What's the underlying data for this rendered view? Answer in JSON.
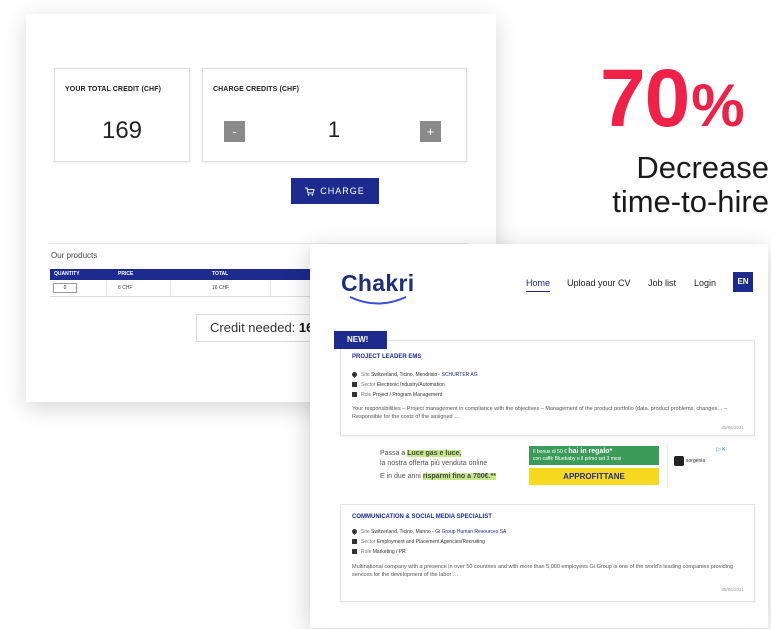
{
  "credit_panel": {
    "total_title": "YOUR TOTAL CREDIT (CHF)",
    "total_value": "169",
    "charge_title": "CHARGE CREDITS (CHF)",
    "minus_label": "-",
    "plus_label": "+",
    "charge_value": "1",
    "charge_button": "CHARGE",
    "products_title": "Our products",
    "products_columns": [
      "QUANTITY",
      "PRICE",
      "TOTAL"
    ],
    "products_row": {
      "quantity": "0",
      "price": "8 CHF",
      "total": "16 CHF"
    },
    "credit_needed_label": "Credit needed:",
    "credit_needed_value": "16"
  },
  "headline": {
    "stat": "70",
    "percent": "%",
    "caption_line1": "Decrease",
    "caption_line2": "time-to-hire"
  },
  "site": {
    "logo": "Chakri",
    "nav": {
      "home": "Home",
      "upload": "Upload your CV",
      "jobs": "Job list",
      "login": "Login",
      "lang": "EN"
    },
    "new_badge": "NEW!",
    "jobs": [
      {
        "title": "PROJECT LEADER EMS",
        "site_label": "Site",
        "site": "Switzerland, Ticino, Mendrisio",
        "company": "SCHURTER AG",
        "sector_label": "Sector",
        "sector": "Electronic Industry/Automation",
        "role_label": "Role",
        "role": "Project / Program Management",
        "description": "Your responsibilities – Project management in compliance with the objectives – Management of the product portfolio (data, product problems, changes… – Responsible for the costs of the assigned …",
        "date": "05/06/2021"
      },
      {
        "title": "COMMUNICATION & SOCIAL MEDIA SPECIALIST",
        "site_label": "Site",
        "site": "Switzerland, Ticino, Manno",
        "company": "Gi Group Human Resources SA",
        "sector_label": "Sector",
        "sector": "Employment and Placement Agencies/Recruiting",
        "role_label": "Role",
        "role": "Marketing / PR",
        "description": "Multinational company with a presence in over 50 countries and with more than 5,000 employees Gi Group is one of the world's leading companies providing services for the development of the labor …",
        "date": "05/06/2021"
      }
    ],
    "ad": {
      "line1_prefix": "Passa a ",
      "line1_highlight": "Luce gas e luce,",
      "line2": "la nostra offerta più venduta online",
      "line3_prefix": "E in due anni ",
      "line3_highlight": "risparmi fino a 700€.**",
      "green_small": "Il bonus di 50 € ",
      "green_big": "hai in regalo*",
      "green_sub": "con caffè Bluebaby e il primo set 3 mesi",
      "cta": "APPROFITTANE",
      "brand": "sorgenia"
    }
  }
}
